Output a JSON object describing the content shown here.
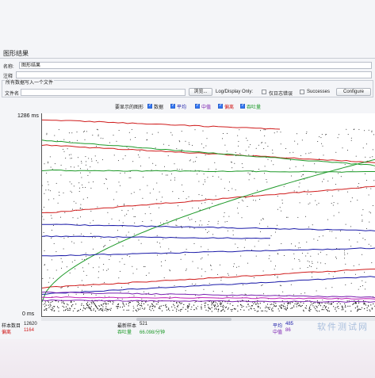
{
  "window_title": "图形结果",
  "name_label": "名称:",
  "name_value": "图形结果",
  "comment_label": "注释",
  "file_group_title": "所有数据写入一个文件",
  "file_label": "文件名",
  "browse_label": "浏览...",
  "log_display_label": "Log/Display Only:",
  "errors_only_label": "仅日志错误",
  "successes_label": "Successes",
  "configure_label": "Configure",
  "series_prompt": "要显示的图形",
  "series": [
    {
      "label": "数据",
      "color": "#111111",
      "checked": true
    },
    {
      "label": "平均",
      "color": "#1a1aa8",
      "checked": true
    },
    {
      "label": "中值",
      "color": "#7a20b0",
      "checked": true
    },
    {
      "label": "偏离",
      "color": "#d01c1c",
      "checked": true
    },
    {
      "label": "吞吐量",
      "color": "#1f9a2a",
      "checked": true
    }
  ],
  "y_max_label": "1286 ms",
  "y_min_label": "0 ms",
  "stats": {
    "samples_label": "样本数目",
    "samples_value": "12620",
    "deviation_label": "偏离",
    "deviation_value": "1164",
    "latest_label": "最新样本",
    "latest_value": "521",
    "throughput_label": "吞吐量",
    "throughput_value": "66.098/分钟",
    "average_label": "平均",
    "average_value": "485",
    "median_label": "中值",
    "median_value": "86"
  },
  "watermark": "软件测试网"
}
